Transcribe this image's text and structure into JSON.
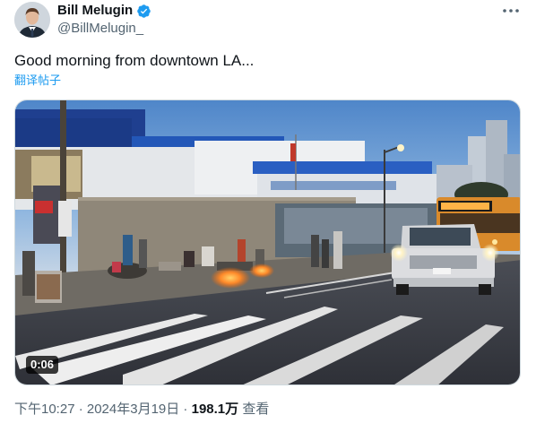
{
  "author": {
    "display_name": "Bill Melugin",
    "handle": "@BillMelugin_",
    "verified": true,
    "avatar_icon": "profile-photo"
  },
  "tweet": {
    "text": "Good morning from downtown LA...",
    "translate_label": "翻译帖子"
  },
  "media": {
    "type": "video",
    "duration": "0:06"
  },
  "meta": {
    "timestamp": "下午10:27 · 2024年3月19日",
    "separator": " · ",
    "views_count": "198.1万",
    "views_label": "查看"
  },
  "colors": {
    "accent": "#1d9bf0",
    "secondary_text": "#536471",
    "primary_text": "#0f1419"
  }
}
